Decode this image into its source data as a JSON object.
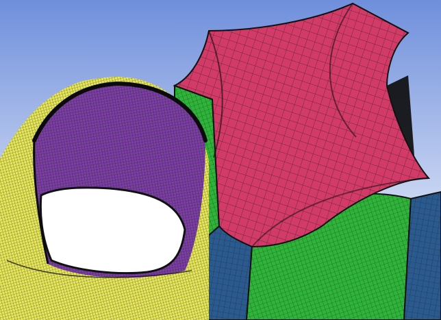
{
  "viewport": {
    "background_top": "#6f8fdc",
    "background_bottom": "#ffffff"
  },
  "meshes": {
    "cylinder_outer_color": "#e6e65a",
    "cylinder_inner_color": "#7b3fa3",
    "block_top_color": "#d23b68",
    "block_side_green_color": "#2fb43a",
    "block_side_blue_color": "#2b5a8f",
    "mesh_line_color": "#111111"
  }
}
